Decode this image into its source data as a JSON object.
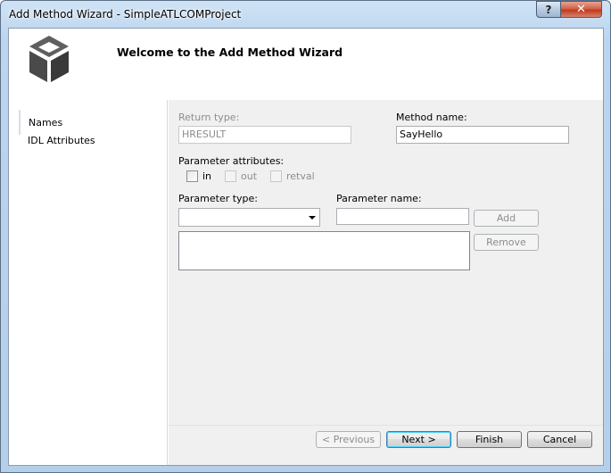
{
  "window": {
    "title": "Add Method Wizard - SimpleATLCOMProject",
    "help_glyph": "?",
    "close_glyph": "✕"
  },
  "header": {
    "title": "Welcome to the Add Method Wizard",
    "icon": "cube-icon"
  },
  "nav": {
    "items": [
      {
        "label": "Names",
        "selected": true
      },
      {
        "label": "IDL Attributes",
        "selected": false
      }
    ]
  },
  "form": {
    "return_type": {
      "label": "Return type:",
      "value": "HRESULT",
      "enabled": false
    },
    "method_name": {
      "label": "Method name:",
      "value": "SayHello"
    },
    "parameter_attributes": {
      "label": "Parameter attributes:",
      "options": [
        {
          "label": "in",
          "checked": false,
          "enabled": true
        },
        {
          "label": "out",
          "checked": false,
          "enabled": false
        },
        {
          "label": "retval",
          "checked": false,
          "enabled": false
        }
      ]
    },
    "parameter_type": {
      "label": "Parameter type:",
      "value": ""
    },
    "parameter_name": {
      "label": "Parameter name:",
      "value": ""
    },
    "add_button": {
      "label": "Add",
      "enabled": false
    },
    "remove_button": {
      "label": "Remove",
      "enabled": false
    },
    "parameter_list": []
  },
  "footer": {
    "previous": {
      "label": "< Previous",
      "enabled": false
    },
    "next": {
      "label": "Next >",
      "enabled": true,
      "default": true
    },
    "finish": {
      "label": "Finish",
      "enabled": true
    },
    "cancel": {
      "label": "Cancel",
      "enabled": true
    }
  },
  "colors": {
    "title_bar": "#bcd5ee",
    "close_button": "#c0391f",
    "panel_background": "#f0f0f0",
    "disabled_text": "#8d8d8d"
  }
}
